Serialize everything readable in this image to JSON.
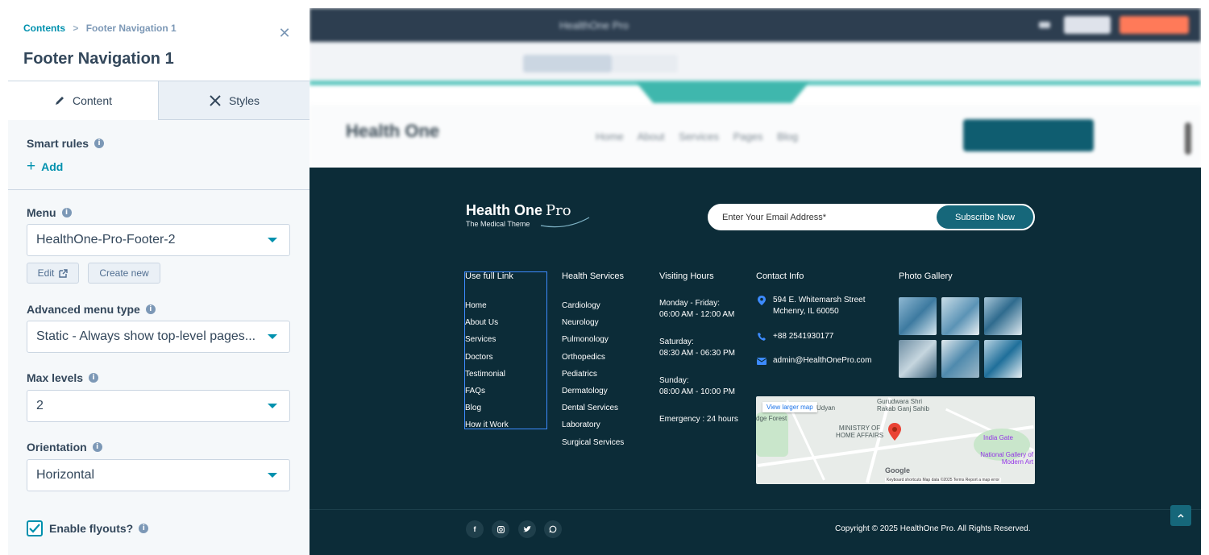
{
  "panel": {
    "breadcrumb": {
      "root": "Contents",
      "separator": ">",
      "current": "Footer Navigation 1"
    },
    "title": "Footer Navigation 1",
    "tabs": [
      {
        "label": "Content"
      },
      {
        "label": "Styles"
      }
    ],
    "smart_rules": {
      "label": "Smart rules",
      "add_label": "Add"
    },
    "menu": {
      "label": "Menu",
      "value": "HealthOne-Pro-Footer-2",
      "edit_label": "Edit",
      "create_label": "Create new"
    },
    "advanced_menu_type": {
      "label": "Advanced menu type",
      "value": "Static - Always show top-level pages..."
    },
    "max_levels": {
      "label": "Max levels",
      "value": "2"
    },
    "orientation": {
      "label": "Orientation",
      "value": "Horizontal"
    },
    "flyouts": {
      "label": "Enable flyouts?",
      "checked": true
    }
  },
  "footer": {
    "brand": {
      "name": "Health One",
      "pro": "Pro",
      "tagline": "The Medical Theme"
    },
    "subscribe": {
      "placeholder": "Enter Your Email Address*",
      "button": "Subscribe Now"
    },
    "useful_links": {
      "title": "Use full Link",
      "items": [
        "Home",
        "About Us",
        "Services",
        "Doctors",
        "Testimonial",
        "FAQs",
        "Blog",
        "How it Work"
      ]
    },
    "health_services": {
      "title": "Health Services",
      "items": [
        "Cardiology",
        "Neurology",
        "Pulmonology",
        "Orthopedics",
        "Pediatrics",
        "Dermatology",
        "Dental Services",
        "Laboratory",
        "Surgical Services"
      ]
    },
    "visiting_hours": {
      "title": "Visiting Hours",
      "weekday_label": "Monday - Friday:",
      "weekday_time": "06:00 AM - 12:00 AM",
      "saturday_label": "Saturday:",
      "saturday_time": "08:30 AM - 06:30 PM",
      "sunday_label": "Sunday:",
      "sunday_time": "08:00 AM - 10:00 PM",
      "emergency": "Emergency : 24 hours"
    },
    "contact": {
      "title": "Contact Info",
      "address_line1": "594 E. Whitemarsh Street",
      "address_line2": "Mchenry, IL 60050",
      "phone": "+88 2541930177",
      "email": "admin@HealthOnePro.com"
    },
    "gallery": {
      "title": "Photo Gallery"
    },
    "map": {
      "button": "View larger map",
      "labels": {
        "gurudwara": "Gurudwara Shri Rakab Ganj Sahib",
        "udyan": "Udyan",
        "ministry": "MINISTRY OF HOME AFFAIRS",
        "india_gate": "India Gate",
        "gallery": "National Gallery of Modern Art",
        "forest": "dge Forest",
        "google": "Google"
      },
      "footer": "Keyboard shortcuts   Map data ©2025   Terms   Report a map error"
    },
    "copyright": "Copyright © 2025 HealthOne Pro. All Rights Reserved."
  },
  "colors": {
    "accent": "#0091ae",
    "footer_bg": "#0c2c38",
    "teal_button": "#16677a"
  }
}
